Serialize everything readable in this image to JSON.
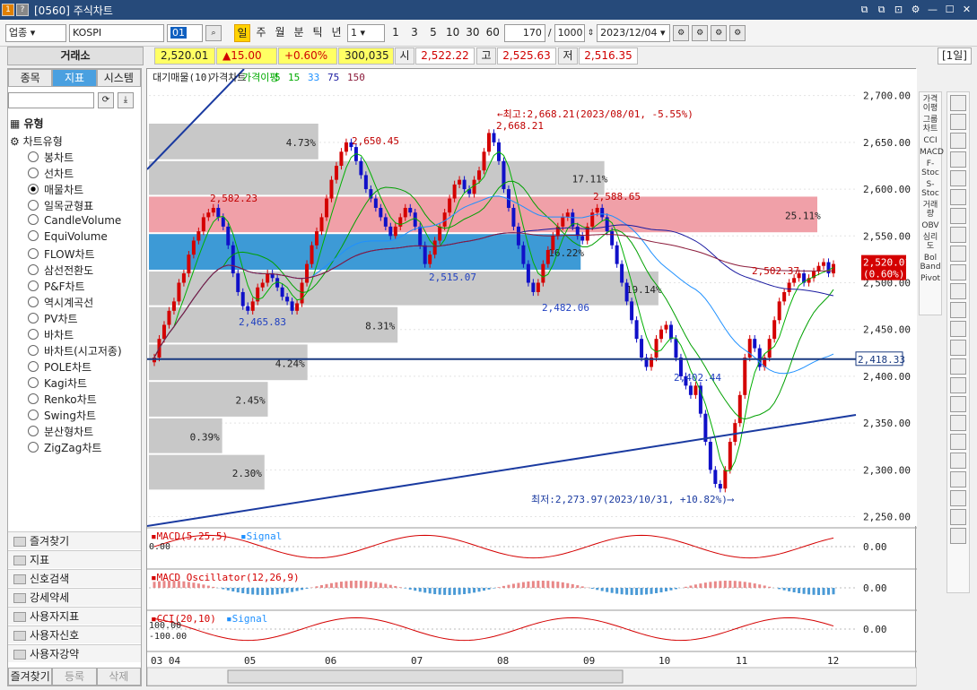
{
  "window": {
    "number": "1",
    "icon2": "?",
    "title": "[0560] 주식차트",
    "buttons": [
      "⧉",
      "⧉",
      "⊡",
      "⚙",
      "—",
      "☐",
      "✕"
    ]
  },
  "toolbar": {
    "market": "업종",
    "code": "KOSPI",
    "color_code": "01",
    "periods": [
      "일",
      "주",
      "월",
      "분",
      "틱",
      "년"
    ],
    "minute_select": "1",
    "intervals": [
      "1",
      "3",
      "5",
      "10",
      "30",
      "60"
    ],
    "count": "170",
    "slash": "/",
    "total": "1000",
    "date": "2023/12/04",
    "tool_icons": [
      "⚙",
      "⚙",
      "⚙",
      "⚙"
    ]
  },
  "quote": {
    "exchange": "거래소",
    "price": "2,520.01",
    "change": "▲15.00",
    "pct": "+0.60%",
    "volume": "300,035",
    "open_label": "시",
    "open": "2,522.22",
    "high_label": "고",
    "high": "2,525.63",
    "low_label": "저",
    "low": "2,516.35",
    "period": "[1일]"
  },
  "left": {
    "tabs": [
      "종목",
      "지표",
      "시스템"
    ],
    "active_tab": 1,
    "type_header": "유형",
    "chart_type": "차트유형",
    "types": [
      "봉차트",
      "선차트",
      "매물차트",
      "일목균형표",
      "CandleVolume",
      "EquiVolume",
      "FLOW차트",
      "삼선전환도",
      "P&F차트",
      "역시계곡선",
      "PV차트",
      "바차트",
      "바차트(시고저종)",
      "POLE차트",
      "Kagi차트",
      "Renko차트",
      "Swing차트",
      "분산형차트",
      "ZigZag차트"
    ],
    "selected": 2,
    "folders": [
      "즐겨찾기",
      "지표",
      "신호검색",
      "강세약세",
      "사용자지표",
      "사용자신호",
      "사용자강약"
    ],
    "bottom": [
      "즐겨찾기",
      "등록",
      "삭제"
    ]
  },
  "right_tool1": [
    "가격이평",
    "그룹차트",
    "CCI",
    "MACD",
    "F-Stoc",
    "S-Stoc",
    "거래량",
    "OBV",
    "심리도",
    "Bol Band",
    "Pivot"
  ],
  "chart_data": {
    "type": "candlestick",
    "legend": [
      "대기매물(10)",
      "가격차트",
      "가격이평",
      "5",
      "15",
      "33",
      "75",
      "150"
    ],
    "legend_colors": [
      "#222222",
      "#222222",
      "#00aa00",
      "#00aa00",
      "#00aa00",
      "#1e90ff",
      "#1a1aa0",
      "#8b1a3a"
    ],
    "ylim": [
      2240,
      2715
    ],
    "yticks": [
      2250,
      2300,
      2350,
      2400,
      2450,
      2500,
      2550,
      2600,
      2650,
      2700
    ],
    "ytick_labels": [
      "2,250.00",
      "2,300.00",
      "2,350.00",
      "2,400.00",
      "2,450.00",
      "2,500.00",
      "2,550.00",
      "2,600.00",
      "2,650.00",
      "2,700.00"
    ],
    "xlabels": [
      "03 04",
      "05",
      "06",
      "07",
      "08",
      "09",
      "10",
      "11",
      "12"
    ],
    "current_price": "2,520.01",
    "current_pct": "(0.60%)",
    "hline_value": 2418.33,
    "hline_label": "2,418.33",
    "volume_profile": [
      {
        "lo": 2630,
        "hi": 2670,
        "pct": "4.73%",
        "color": "#c8c8c8"
      },
      {
        "lo": 2592,
        "hi": 2630,
        "pct": "17.11%",
        "color": "#c8c8c8"
      },
      {
        "lo": 2552,
        "hi": 2592,
        "pct": "25.11%",
        "color": "#f0a0a8"
      },
      {
        "lo": 2512,
        "hi": 2552,
        "pct": "16.22%",
        "color": "#3d9ad6"
      },
      {
        "lo": 2474,
        "hi": 2512,
        "pct": "19.14%",
        "color": "#c8c8c8"
      },
      {
        "lo": 2434,
        "hi": 2474,
        "pct": "8.31%",
        "color": "#c8c8c8"
      },
      {
        "lo": 2394,
        "hi": 2434,
        "pct": "4.24%",
        "color": "#c8c8c8"
      },
      {
        "lo": 2355,
        "hi": 2394,
        "pct": "2.45%",
        "color": "#c8c8c8"
      },
      {
        "lo": 2316,
        "hi": 2355,
        "pct": "0.39%",
        "color": "#c8c8c8"
      },
      {
        "lo": 2277,
        "hi": 2316,
        "pct": "2.30%",
        "color": "#c8c8c8"
      }
    ],
    "annotations": [
      {
        "text": "2,582.23",
        "color": "#c00000"
      },
      {
        "text": "2,465.83",
        "color": "#2040c0"
      },
      {
        "text": "2,650.45",
        "color": "#c00000"
      },
      {
        "text": "2,515.07",
        "color": "#2040c0"
      },
      {
        "text": "2,668.21",
        "color": "#c00000"
      },
      {
        "text": "2,588.65",
        "color": "#c00000"
      },
      {
        "text": "2,482.06",
        "color": "#2040c0"
      },
      {
        "text": "2,402.44",
        "color": "#2040c0"
      },
      {
        "text": "2,502.37",
        "color": "#c00000"
      }
    ],
    "high_note": "←최고:2,668.21(2023/08/01, -5.55%)",
    "low_note": "최저:2,273.97(2023/10/31, +10.82%)⟶",
    "closes": [
      2420,
      2440,
      2455,
      2470,
      2480,
      2500,
      2510,
      2530,
      2545,
      2555,
      2570,
      2575,
      2580,
      2570,
      2560,
      2540,
      2510,
      2490,
      2475,
      2470,
      2480,
      2495,
      2500,
      2510,
      2505,
      2495,
      2485,
      2480,
      2470,
      2478,
      2500,
      2520,
      2540,
      2555,
      2570,
      2590,
      2610,
      2625,
      2640,
      2650,
      2645,
      2630,
      2615,
      2600,
      2590,
      2580,
      2570,
      2560,
      2550,
      2560,
      2570,
      2580,
      2575,
      2560,
      2540,
      2520,
      2530,
      2545,
      2560,
      2575,
      2590,
      2605,
      2610,
      2600,
      2595,
      2610,
      2620,
      2640,
      2660,
      2650,
      2630,
      2600,
      2580,
      2560,
      2540,
      2520,
      2500,
      2490,
      2500,
      2520,
      2535,
      2550,
      2560,
      2570,
      2575,
      2560,
      2550,
      2545,
      2560,
      2575,
      2580,
      2570,
      2555,
      2540,
      2520,
      2500,
      2480,
      2460,
      2440,
      2420,
      2410,
      2420,
      2440,
      2450,
      2455,
      2440,
      2420,
      2400,
      2390,
      2380,
      2390,
      2360,
      2330,
      2300,
      2285,
      2280,
      2300,
      2330,
      2350,
      2380,
      2420,
      2440,
      2430,
      2410,
      2420,
      2440,
      2460,
      2480,
      2490,
      2500,
      2505,
      2510,
      2500,
      2505,
      2512,
      2518,
      2522,
      2510,
      2520
    ],
    "ma_labels": [
      "MACD(5,25,5)",
      "Signal",
      "MACD Oscillator(12,26,9)",
      "CCI(20,10)",
      "Signal"
    ],
    "sub_values": [
      "0.00",
      "0.00",
      "0.00"
    ],
    "sub_left": [
      "0.00",
      "100.00",
      "-100.00"
    ]
  }
}
